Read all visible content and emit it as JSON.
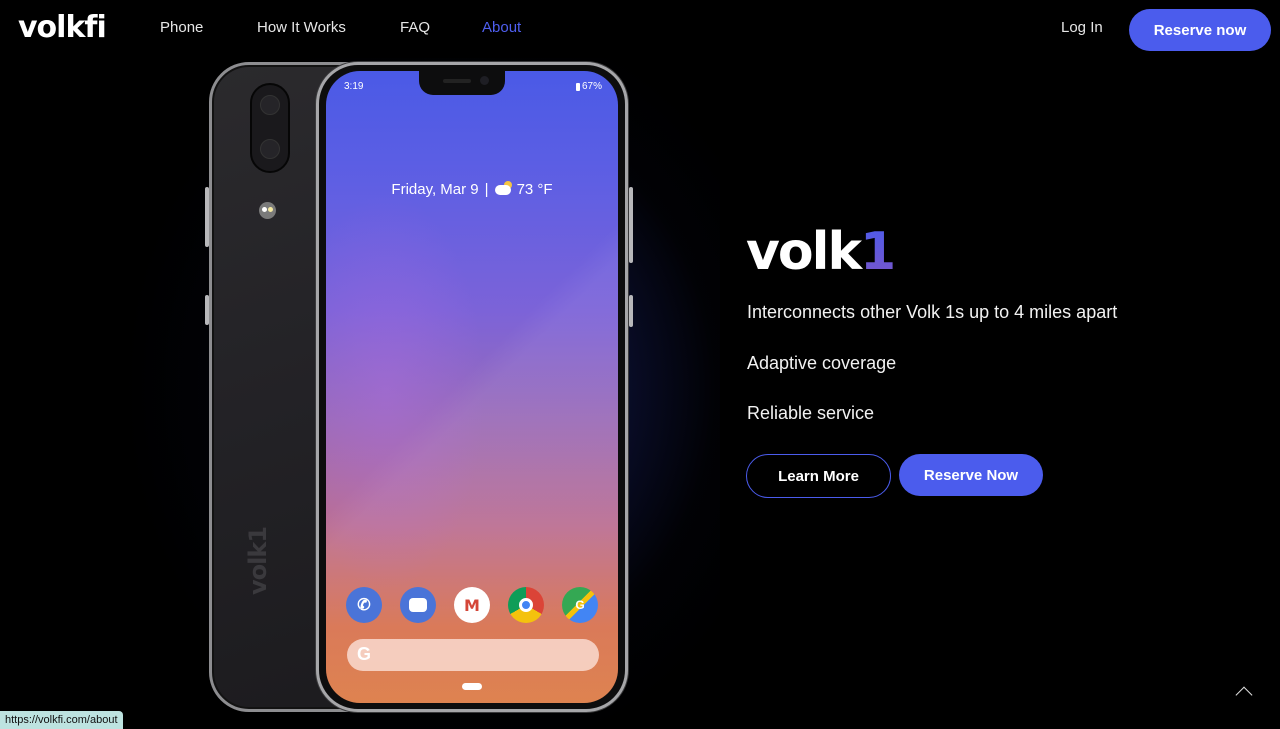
{
  "nav": {
    "logo": "volkfi",
    "links": [
      {
        "label": "Phone",
        "active": false
      },
      {
        "label": "How It Works",
        "active": false
      },
      {
        "label": "FAQ",
        "active": false
      },
      {
        "label": "About",
        "active": true
      }
    ],
    "login_label": "Log In",
    "reserve_label": "Reserve now"
  },
  "phone_screen": {
    "time": "3:19",
    "battery": "67%",
    "date": "Friday, Mar 9",
    "separator": "|",
    "temperature": "73 °F",
    "dock_apps": [
      "phone-icon",
      "messages-icon",
      "gmail-icon",
      "chrome-icon",
      "maps-icon"
    ],
    "gmail_glyph": "M",
    "maps_glyph": "G",
    "search_glyph": "G"
  },
  "phone_back": {
    "brand": "volk1"
  },
  "hero": {
    "title_main": "volk",
    "title_accent": "1",
    "features": [
      "Interconnects other Volk 1s up to 4 miles apart",
      "Adaptive coverage",
      "Reliable service"
    ],
    "learn_more_label": "Learn More",
    "reserve_label": "Reserve Now"
  },
  "status_bar": {
    "url": "https://volkfi.com/about"
  },
  "colors": {
    "accent": "#4b5ced",
    "background": "#000000",
    "status_url_bg": "#bde3e0"
  }
}
